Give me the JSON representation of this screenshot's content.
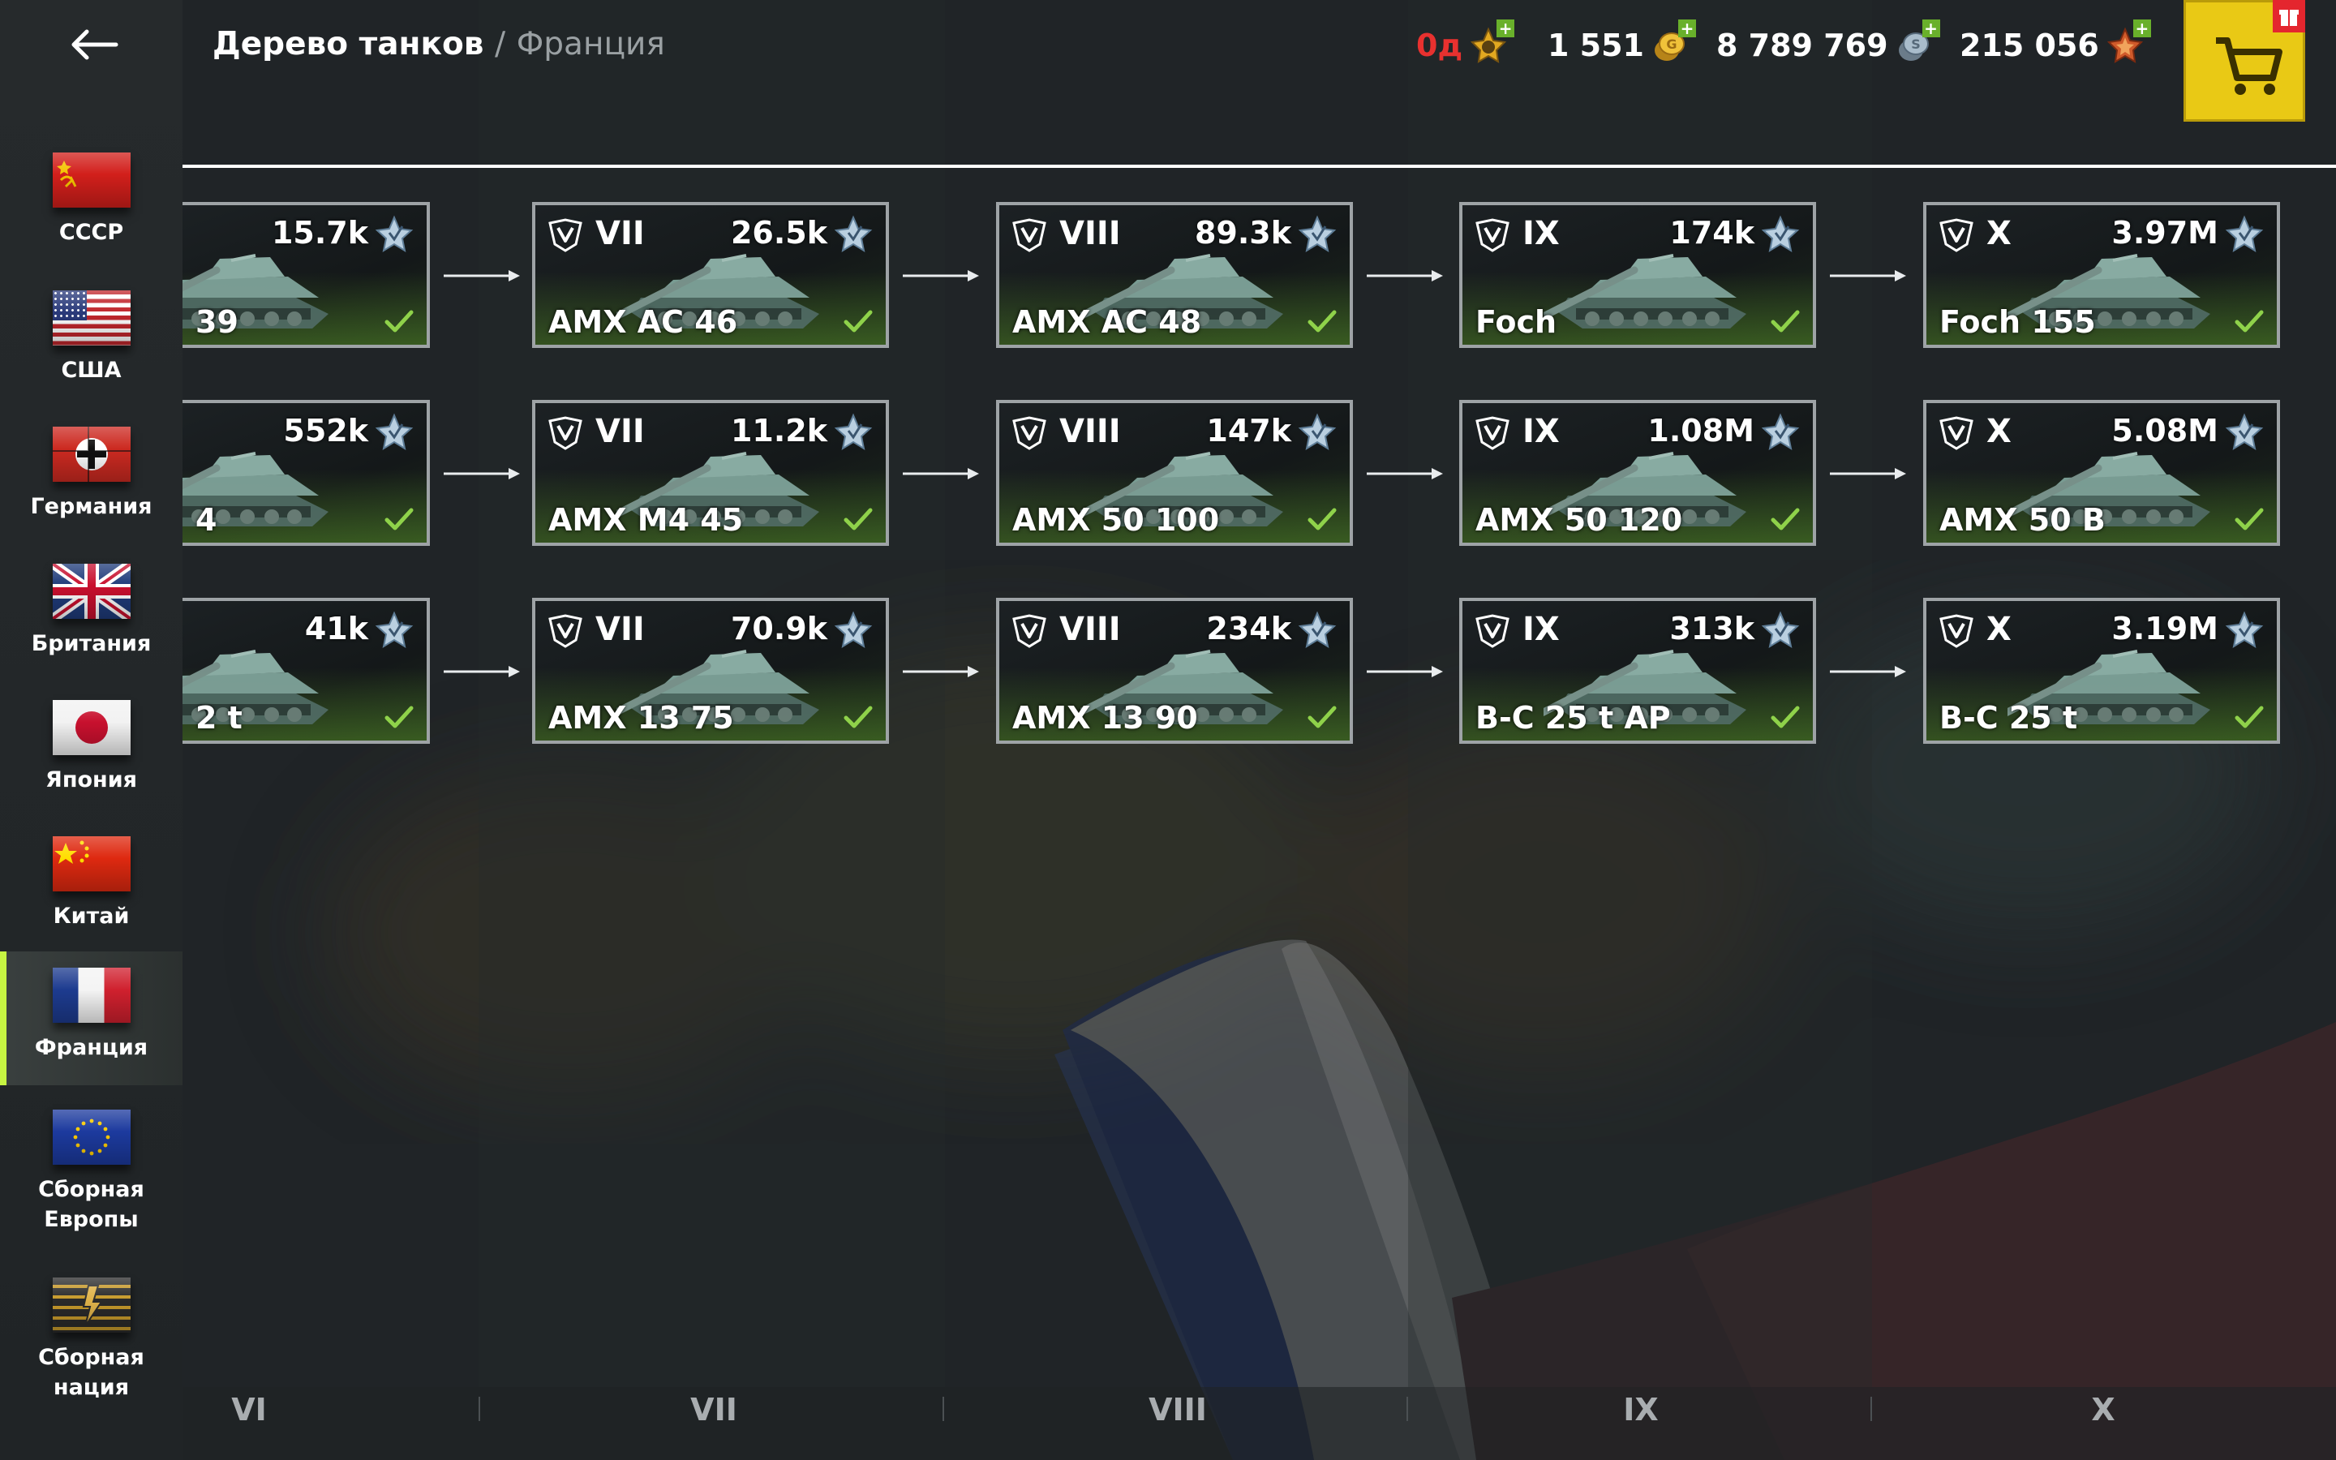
{
  "header": {
    "title": "Дерево танков",
    "separator": "/",
    "nation": "Франция"
  },
  "currencies": [
    {
      "id": "gold-booster",
      "value": "0д",
      "color": "#e8312f",
      "icon": "clock-booster-icon"
    },
    {
      "id": "gold",
      "value": "1 551",
      "color": "#ffffff",
      "icon": "gold-coin-icon"
    },
    {
      "id": "credits",
      "value": "8 789 769",
      "color": "#ffffff",
      "icon": "silver-coin-icon"
    },
    {
      "id": "free-xp",
      "value": "215 056",
      "color": "#ffffff",
      "icon": "free-xp-star-icon"
    }
  ],
  "shop": {
    "icon": "shopping-cart-icon"
  },
  "nations": [
    {
      "key": "ussr",
      "label": "СССР",
      "active": false
    },
    {
      "key": "usa",
      "label": "США",
      "active": false
    },
    {
      "key": "germany",
      "label": "Германия",
      "active": false
    },
    {
      "key": "uk",
      "label": "Британия",
      "active": false
    },
    {
      "key": "japan",
      "label": "Япония",
      "active": false
    },
    {
      "key": "china",
      "label": "Китай",
      "active": false
    },
    {
      "key": "france",
      "label": "Франция",
      "active": true
    },
    {
      "key": "europe",
      "label": "Сборная Европы",
      "active": false
    },
    {
      "key": "hybrid",
      "label": "Сборная нация",
      "active": false
    }
  ],
  "rows": [
    [
      {
        "tier": "",
        "name": "39",
        "xp": "15.7k",
        "researched": true,
        "partial": true
      },
      {
        "tier": "VII",
        "name": "AMX AC 46",
        "xp": "26.5k",
        "researched": true
      },
      {
        "tier": "VIII",
        "name": "AMX AC 48",
        "xp": "89.3k",
        "researched": true
      },
      {
        "tier": "IX",
        "name": "Foch",
        "xp": "174k",
        "researched": true
      },
      {
        "tier": "X",
        "name": "Foch 155",
        "xp": "3.97M",
        "researched": true
      }
    ],
    [
      {
        "tier": "",
        "name": "4",
        "xp": "552k",
        "researched": true,
        "partial": true
      },
      {
        "tier": "VII",
        "name": "AMX M4 45",
        "xp": "11.2k",
        "researched": true
      },
      {
        "tier": "VIII",
        "name": "AMX 50 100",
        "xp": "147k",
        "researched": true
      },
      {
        "tier": "IX",
        "name": "AMX 50 120",
        "xp": "1.08M",
        "researched": true
      },
      {
        "tier": "X",
        "name": "AMX 50 B",
        "xp": "5.08M",
        "researched": true
      }
    ],
    [
      {
        "tier": "",
        "name": "2 t",
        "xp": "41k",
        "researched": true,
        "partial": true
      },
      {
        "tier": "VII",
        "name": "AMX 13 75",
        "xp": "70.9k",
        "researched": true
      },
      {
        "tier": "VIII",
        "name": "AMX 13 90",
        "xp": "234k",
        "researched": true
      },
      {
        "tier": "IX",
        "name": "B-C 25 t AP",
        "xp": "313k",
        "researched": true
      },
      {
        "tier": "X",
        "name": "B-C 25 t",
        "xp": "3.19M",
        "researched": true
      }
    ]
  ],
  "tiers": [
    "VI",
    "VII",
    "VIII",
    "IX",
    "X"
  ],
  "colors": {
    "accent": "#c6f542",
    "check": "#8fd24a",
    "shop": "#e9c915",
    "alert": "#e8312f"
  }
}
